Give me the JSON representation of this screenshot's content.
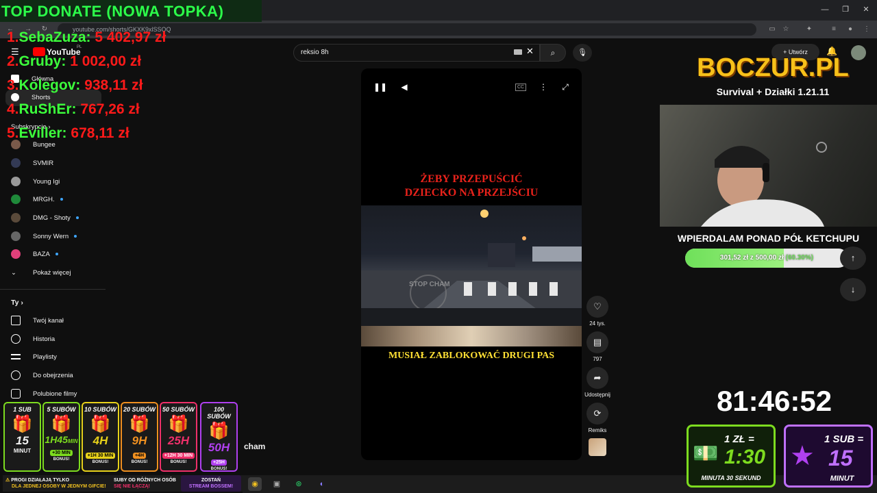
{
  "browser": {
    "url": "youtube.com/shorts/GKXK9xlSSOQ",
    "window_controls": [
      "—",
      "❐",
      "✕"
    ]
  },
  "youtube": {
    "logo_text": "YouTube",
    "logo_region": "PL",
    "search_value": "reksio 8h",
    "create_label": "Utwórz",
    "sidebar": {
      "home": "Główna",
      "shorts": "Shorts",
      "subs_header": "Subskrypcje",
      "subs": [
        {
          "name": "Bungee",
          "color": "#7a5a4a",
          "dot": false
        },
        {
          "name": "SVMIR",
          "color": "#333a55",
          "dot": false
        },
        {
          "name": "Young Igi",
          "color": "#9a9a9a",
          "dot": false
        },
        {
          "name": "MRGH.",
          "color": "#1f8a3a",
          "dot": true
        },
        {
          "name": "DMG - Shoty",
          "color": "#5a4a3a",
          "dot": true
        },
        {
          "name": "Sonny Wern",
          "color": "#666666",
          "dot": true
        },
        {
          "name": "BAZA",
          "color": "#e0407a",
          "dot": true
        }
      ],
      "show_more": "Pokaż więcej",
      "you_header": "Ty",
      "you_items": [
        "Twój kanał",
        "Historia",
        "Playlisty",
        "Do obejrzenia",
        "Polubione filmy"
      ]
    },
    "video": {
      "caption_top_1": "ŻEBY PRZEPUŚCIĆ",
      "caption_top_2": "DZIECKO NA PRZEJŚCIU",
      "caption_bottom": "MUSIAŁ ZABLOKOWAĆ DRUGI PAS",
      "watermark": "STOP CHAM",
      "cc_label": "CC"
    },
    "actions": {
      "likes": "24 tys.",
      "comments": "797",
      "share": "Udostępnij",
      "remix": "Remiks"
    },
    "partial_channel": "cham"
  },
  "overlay": {
    "top_donate_title": "TOP DONATE (NOWA TOPKA)",
    "donors": [
      {
        "rank": "1.",
        "name": "SebaZuza:",
        "amount": "5 402,97 zł"
      },
      {
        "rank": "2.",
        "name": "Gruby:",
        "amount": "1 002,00 zł"
      },
      {
        "rank": "3.",
        "name": "Kolegov:",
        "amount": "938,11 zł"
      },
      {
        "rank": "4.",
        "name": "RuShEr:",
        "amount": "767,26 zł"
      },
      {
        "rank": "5.",
        "name": "Eviller:",
        "amount": "678,11 zł"
      }
    ],
    "logo_title": "BOCZUR.PL",
    "logo_subtitle": "Survival + Działki 1.21.11",
    "goal": {
      "title": "WPIERDALAM PONAD PÓŁ KETCHUPU",
      "text": "301,52 zł z 500,00 zł",
      "percent_text": "(60.30%)",
      "fraction": 0.603
    },
    "timer": "81:46:52",
    "sub_cards": [
      {
        "title": "1 SUB",
        "value": "15",
        "unit": "MINUT",
        "bonus": "",
        "color": "#7ddc1f"
      },
      {
        "title": "5 SUBÓW",
        "value": "1H45",
        "unit": "MIN",
        "bonus": "+30 MIN",
        "color": "#7ddc1f"
      },
      {
        "title": "10 SUBÓW",
        "value": "4H",
        "unit": "",
        "bonus": "+1H 30 MIN",
        "color": "#e8d21a"
      },
      {
        "title": "20 SUBÓW",
        "value": "9H",
        "unit": "",
        "bonus": "+4H",
        "color": "#f09020"
      },
      {
        "title": "50 SUBÓW",
        "value": "25H",
        "unit": "",
        "bonus": "+12H 30 MIN",
        "color": "#f0306a"
      },
      {
        "title": "100 SUBÓW",
        "value": "50H",
        "unit": "",
        "bonus": "+25H",
        "color": "#b040f0"
      }
    ],
    "bonus_label": "BONUS!",
    "rules": {
      "r1a": "PROGI DZIAŁAJĄ TYLKO",
      "r1b": "DLA JEDNEJ OSOBY W JEDNYM GIFCIE!",
      "r2a": "SUBY OD RÓŻNYCH OSÓB",
      "r2b": "SIĘ NIE ŁĄCZĄ!",
      "r3a": "ZOSTAŃ",
      "r3b": "STREAM BOSSEM!"
    },
    "rate_money": {
      "top": "1 ZŁ =",
      "value": "1:30",
      "bottom": "MINUTA 30 SEKUND"
    },
    "rate_sub": {
      "top": "1 SUB =",
      "value": "15",
      "bottom": "MINUT"
    }
  }
}
